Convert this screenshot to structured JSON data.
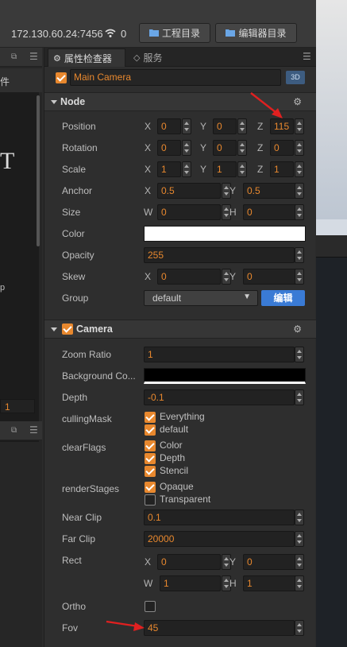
{
  "topbar": {
    "ip": "172.130.60.24:7456",
    "count": "0",
    "project_btn": "工程目录",
    "editor_btn": "编辑器目录"
  },
  "left_panel": {
    "partial_label": "件",
    "partial_glyph_t": "T",
    "partial_glyph_p": "p",
    "field_value": "1"
  },
  "tabs": {
    "inspector": "属性检查器",
    "services": "服务"
  },
  "node_name": "Main Camera",
  "badge_3d": "3D",
  "node": {
    "title": "Node",
    "position": {
      "label": "Position",
      "x": "0",
      "y": "0",
      "z": "115"
    },
    "rotation": {
      "label": "Rotation",
      "x": "0",
      "y": "0",
      "z": "0"
    },
    "scale": {
      "label": "Scale",
      "x": "1",
      "y": "1",
      "z": "1"
    },
    "anchor": {
      "label": "Anchor",
      "x": "0.5",
      "y": "0.5"
    },
    "size": {
      "label": "Size",
      "w": "0",
      "h": "0"
    },
    "color": {
      "label": "Color",
      "value": "#ffffff"
    },
    "opacity": {
      "label": "Opacity",
      "value": "255"
    },
    "skew": {
      "label": "Skew",
      "x": "0",
      "y": "0"
    },
    "group": {
      "label": "Group",
      "value": "default",
      "edit_btn": "编辑"
    }
  },
  "camera": {
    "title": "Camera",
    "zoom_ratio": {
      "label": "Zoom Ratio",
      "value": "1"
    },
    "background_color": {
      "label": "Background Co...",
      "value": "#000000"
    },
    "depth": {
      "label": "Depth",
      "value": "-0.1"
    },
    "culling_mask": {
      "label": "cullingMask",
      "options": [
        "Everything",
        "default"
      ]
    },
    "clear_flags": {
      "label": "clearFlags",
      "options": [
        "Color",
        "Depth",
        "Stencil"
      ]
    },
    "render_stages": {
      "label": "renderStages",
      "opaque": "Opaque",
      "transparent": "Transparent"
    },
    "near_clip": {
      "label": "Near Clip",
      "value": "0.1"
    },
    "far_clip": {
      "label": "Far Clip",
      "value": "20000"
    },
    "rect": {
      "label": "Rect",
      "x": "0",
      "y": "0",
      "w": "1",
      "h": "1"
    },
    "ortho": {
      "label": "Ortho"
    },
    "fov": {
      "label": "Fov",
      "value": "45"
    }
  },
  "axes": {
    "x": "X",
    "y": "Y",
    "z": "Z",
    "w": "W",
    "h": "H"
  },
  "colors": {
    "accent": "#e8882e",
    "edit_button": "#3a7bd5",
    "annotation_arrow": "#e02020"
  }
}
